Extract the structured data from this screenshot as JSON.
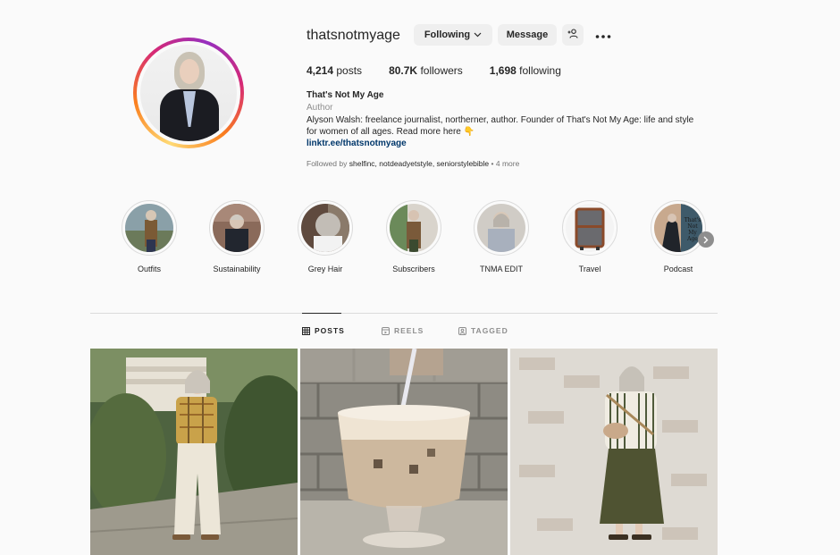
{
  "profile": {
    "username": "thatsnotmyage",
    "buttons": {
      "following": "Following",
      "message": "Message"
    },
    "stats": [
      {
        "value": "4,214",
        "label": "posts"
      },
      {
        "value": "80.7K",
        "label": "followers"
      },
      {
        "value": "1,698",
        "label": "following"
      }
    ],
    "full_name": "That's Not My Age",
    "category": "Author",
    "bio_line1": "Alyson Walsh: freelance journalist, northerner, author. Founder of That's Not My Age: life and style",
    "bio_line2": "for women of all ages. Read more here 👇",
    "link": "linktr.ee/thatsnotmyage",
    "followed_by_prefix": "Followed by",
    "followed_by_names": "shelfinc, notdeadyetstyle, seniorstylebible",
    "followed_by_more": "• 4 more"
  },
  "highlights": [
    {
      "label": "Outfits"
    },
    {
      "label": "Sustainability"
    },
    {
      "label": "Grey Hair"
    },
    {
      "label": "Subscribers"
    },
    {
      "label": "TNMA EDIT"
    },
    {
      "label": "Travel"
    },
    {
      "label": "Podcast"
    }
  ],
  "podcast_cover_text": "That's Not My Age",
  "tabs": [
    {
      "label": "POSTS",
      "active": true
    },
    {
      "label": "REELS",
      "active": false
    },
    {
      "label": "TAGGED",
      "active": false
    }
  ],
  "icons": {
    "chevron": "chevron-down-icon",
    "add_user": "add-user-icon",
    "more": "more-options-icon",
    "next": "chevron-right-icon"
  },
  "colors": {
    "button_bg": "#efefef",
    "link": "#00376b",
    "muted": "#8e8e8e"
  }
}
